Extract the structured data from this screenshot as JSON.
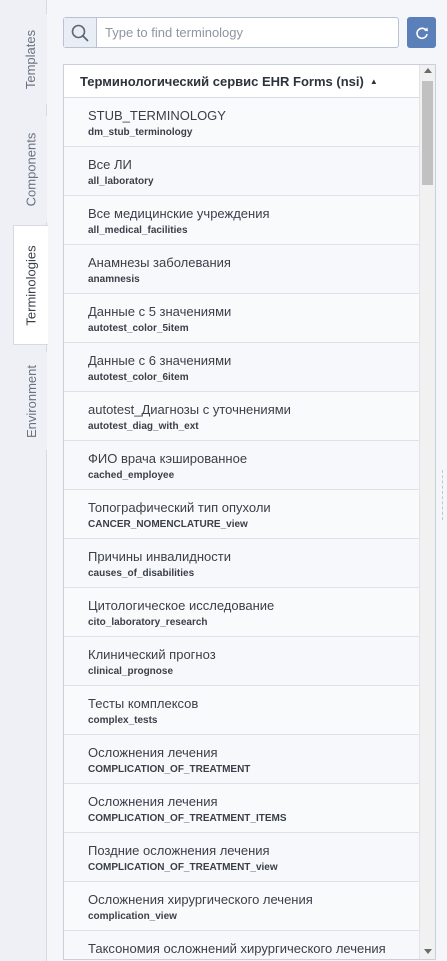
{
  "side_tabs": [
    {
      "label": "Templates",
      "active": false
    },
    {
      "label": "Components",
      "active": false
    },
    {
      "label": "Terminologies",
      "active": true
    },
    {
      "label": "Environment",
      "active": false
    }
  ],
  "search": {
    "placeholder": "Type to find terminology",
    "value": "",
    "icon": "search-icon"
  },
  "refresh_icon": "refresh-icon",
  "list": {
    "header": "Терминологический сервис EHR Forms (nsi)",
    "sort_indicator": "▲",
    "items": [
      {
        "title": "STUB_TERMINOLOGY",
        "code": "dm_stub_terminology"
      },
      {
        "title": "Все ЛИ",
        "code": "all_laboratory"
      },
      {
        "title": "Все медицинские учреждения",
        "code": "all_medical_facilities"
      },
      {
        "title": "Анамнезы заболевания",
        "code": "anamnesis"
      },
      {
        "title": "Данные с 5 значениями",
        "code": "autotest_color_5item"
      },
      {
        "title": "Данные с 6 значениями",
        "code": "autotest_color_6item"
      },
      {
        "title": "autotest_Диагнозы с уточнениями",
        "code": "autotest_diag_with_ext"
      },
      {
        "title": "ФИО врача кэшированное",
        "code": "cached_employee"
      },
      {
        "title": "Топографический тип опухоли",
        "code": "CANCER_NOMENCLATURE_view"
      },
      {
        "title": "Причины инвалидности",
        "code": "causes_of_disabilities"
      },
      {
        "title": "Цитологическое исследование",
        "code": "cito_laboratory_research"
      },
      {
        "title": "Клинический прогноз",
        "code": "clinical_prognose"
      },
      {
        "title": "Тесты комплексов",
        "code": "complex_tests"
      },
      {
        "title": "Осложнения лечения",
        "code": "COMPLICATION_OF_TREATMENT"
      },
      {
        "title": "Осложнения лечения",
        "code": "COMPLICATION_OF_TREATMENT_ITEMS"
      },
      {
        "title": "Поздние осложнения лечения",
        "code": "COMPLICATION_OF_TREATMENT_view"
      },
      {
        "title": "Осложнения хирургического лечения",
        "code": "complication_view"
      },
      {
        "title": "Таксономия осложнений хирургического лечения",
        "code": ""
      }
    ]
  },
  "colors": {
    "accent": "#5b7fb8",
    "border": "#c9cfdb",
    "text": "#3a3f48"
  }
}
